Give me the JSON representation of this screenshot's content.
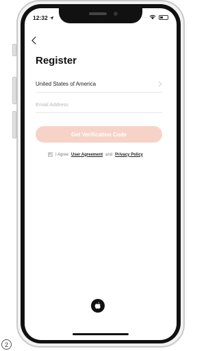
{
  "status_bar": {
    "time": "12:32",
    "signal_dots": "....",
    "location_icon": "location-arrow-icon",
    "wifi_icon": "wifi-icon",
    "battery_icon": "battery-icon"
  },
  "nav": {
    "back_icon": "chevron-left-icon"
  },
  "page": {
    "title": "Register"
  },
  "form": {
    "country_value": "United States of America",
    "email_placeholder": "Email Address",
    "email_value": "",
    "verify_button_label": "Get Verification Code",
    "verify_button_color": "#f7d3c7"
  },
  "agreement": {
    "prefix": "I Agree",
    "user_agreement": "User Agreement",
    "conjunction": "and",
    "privacy_policy": "Privacy Policy",
    "checked": true
  },
  "social": {
    "apple_icon": "apple-logo-icon"
  },
  "annotation": {
    "step_number": "2"
  }
}
